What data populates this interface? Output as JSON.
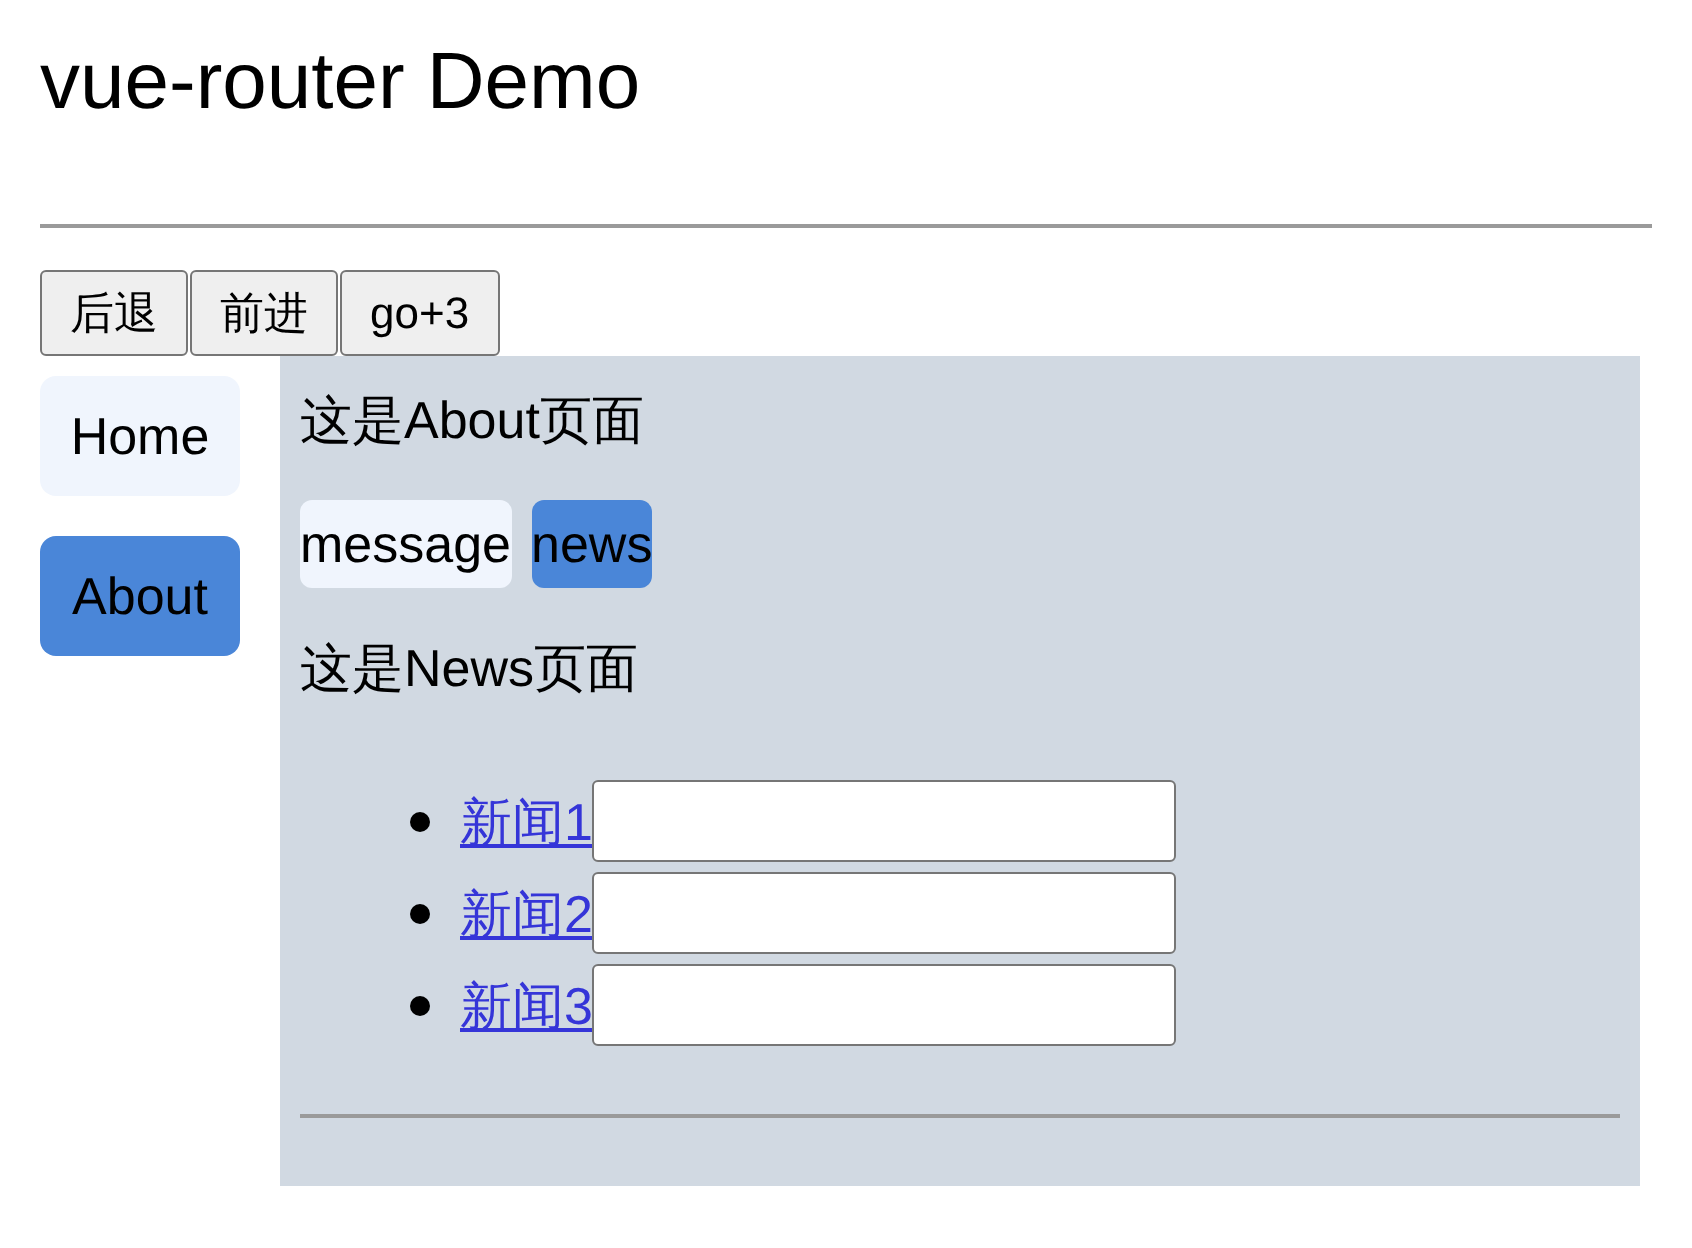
{
  "title": "vue-router Demo",
  "history_buttons": [
    "后退",
    "前进",
    "go+3"
  ],
  "nav": [
    {
      "label": "Home",
      "selected": false
    },
    {
      "label": "About",
      "selected": true
    }
  ],
  "page": {
    "heading": "这是About页面",
    "tabs": [
      {
        "label": "message",
        "selected": false
      },
      {
        "label": "news",
        "selected": true
      }
    ],
    "subheading": "这是News页面",
    "news": [
      {
        "link": "新闻1"
      },
      {
        "link": "新闻2"
      },
      {
        "link": "新闻3"
      }
    ]
  }
}
